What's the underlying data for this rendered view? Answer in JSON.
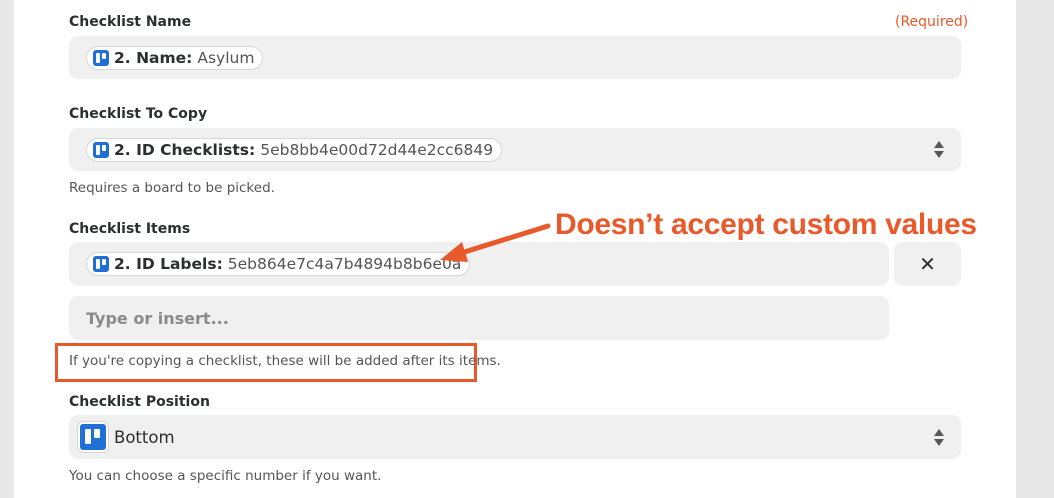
{
  "fields": {
    "checklist_name": {
      "label": "Checklist Name",
      "required": "(Required)",
      "chip_key": "2. Name:",
      "chip_value": "Asylum"
    },
    "checklist_to_copy": {
      "label": "Checklist To Copy",
      "chip_key": "2. ID Checklists:",
      "chip_value": "5eb8bb4e00d72d44e2cc6849",
      "hint": "Requires a board to be picked."
    },
    "checklist_items": {
      "label": "Checklist Items",
      "chip_key": "2. ID Labels:",
      "chip_value": "5eb864e7c4a7b4894b8b6e0a",
      "remove": "✕",
      "input_placeholder": "Type or insert...",
      "hint": "If you're copying a checklist, these will be added after its items."
    },
    "checklist_position": {
      "label": "Checklist Position",
      "value": "Bottom",
      "hint": "You can choose a specific number if you want."
    }
  },
  "annotation": {
    "text": "Doesn’t accept custom values",
    "color": "#e8592b"
  },
  "icons": {
    "chip_icon": "trello-icon",
    "select_icon": "up-down-chevron-icon",
    "remove_icon": "close-icon"
  }
}
